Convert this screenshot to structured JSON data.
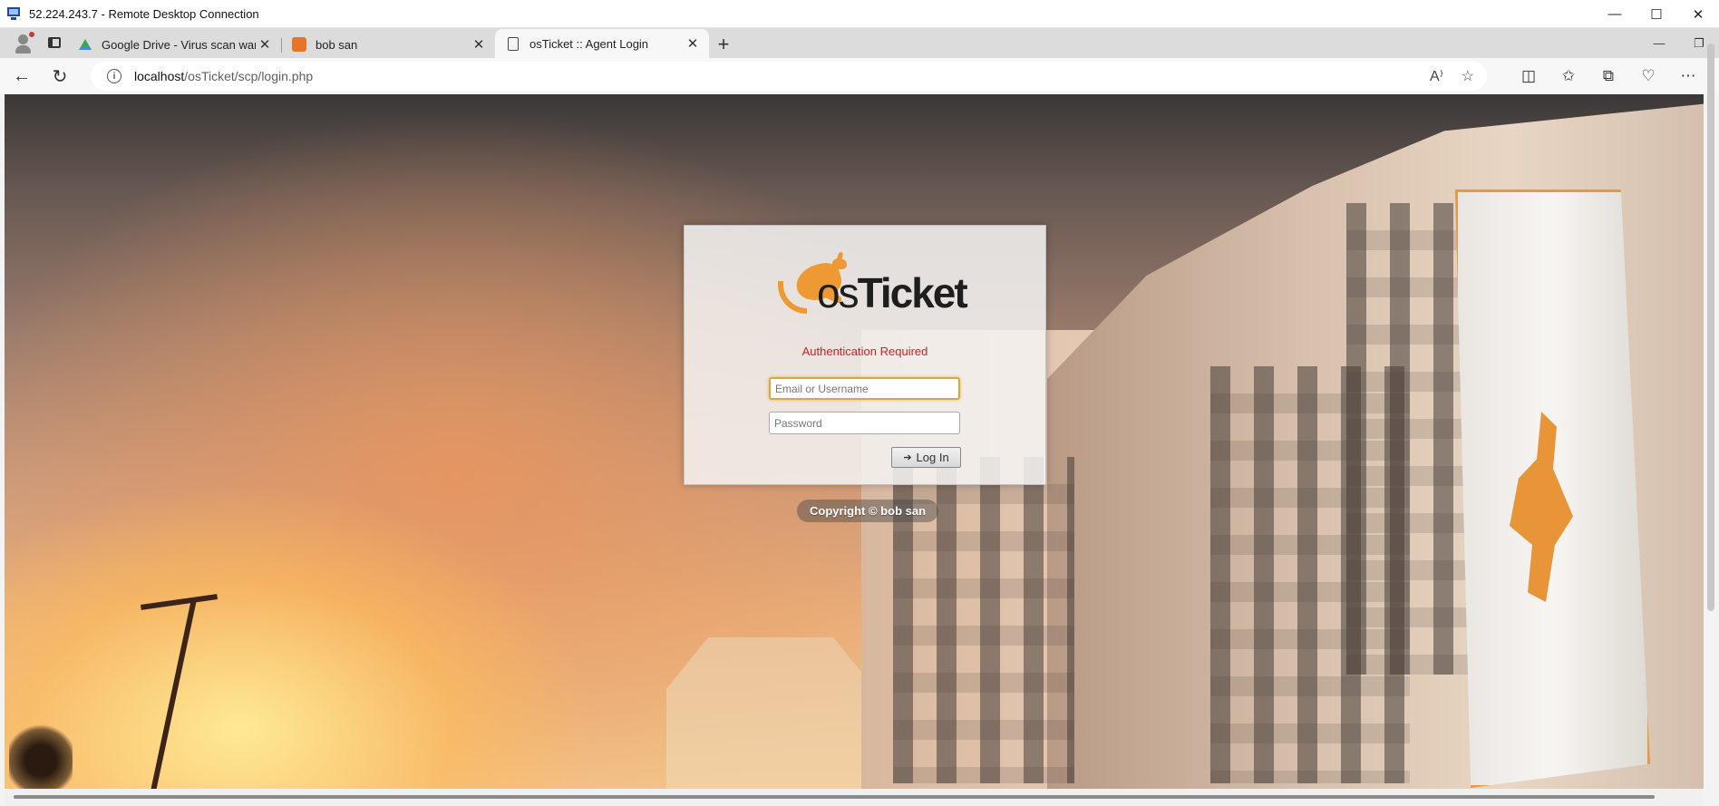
{
  "rdp": {
    "title": "52.224.243.7 - Remote Desktop Connection",
    "controls": [
      "—",
      "☐",
      "✕"
    ]
  },
  "browser": {
    "tabs": [
      {
        "label": "Google Drive - Virus scan warning",
        "favicon": "google-drive-icon"
      },
      {
        "label": "bob san",
        "favicon": "bob-san-icon"
      },
      {
        "label": "osTicket :: Agent Login",
        "favicon": "page-icon",
        "active": true
      }
    ],
    "address": {
      "host": "localhost",
      "path": "/osTicket/scp/login.php"
    },
    "icons": [
      "back-icon",
      "refresh-icon",
      "info-icon",
      "read-aloud-icon",
      "favorite-star-icon",
      "split-screen-icon",
      "favorites-icon",
      "collections-icon",
      "browser-essentials-icon",
      "more-icon"
    ]
  },
  "login": {
    "logo_os": "os",
    "logo_ticket": "Ticket",
    "message": "Authentication Required",
    "username_placeholder": "Email or Username",
    "password_placeholder": "Password",
    "button_label": "Log In",
    "copyright": "Copyright © bob san"
  },
  "colors": {
    "accent": "#ee9933",
    "error": "#d01f1f",
    "focus": "#e3a72f"
  }
}
